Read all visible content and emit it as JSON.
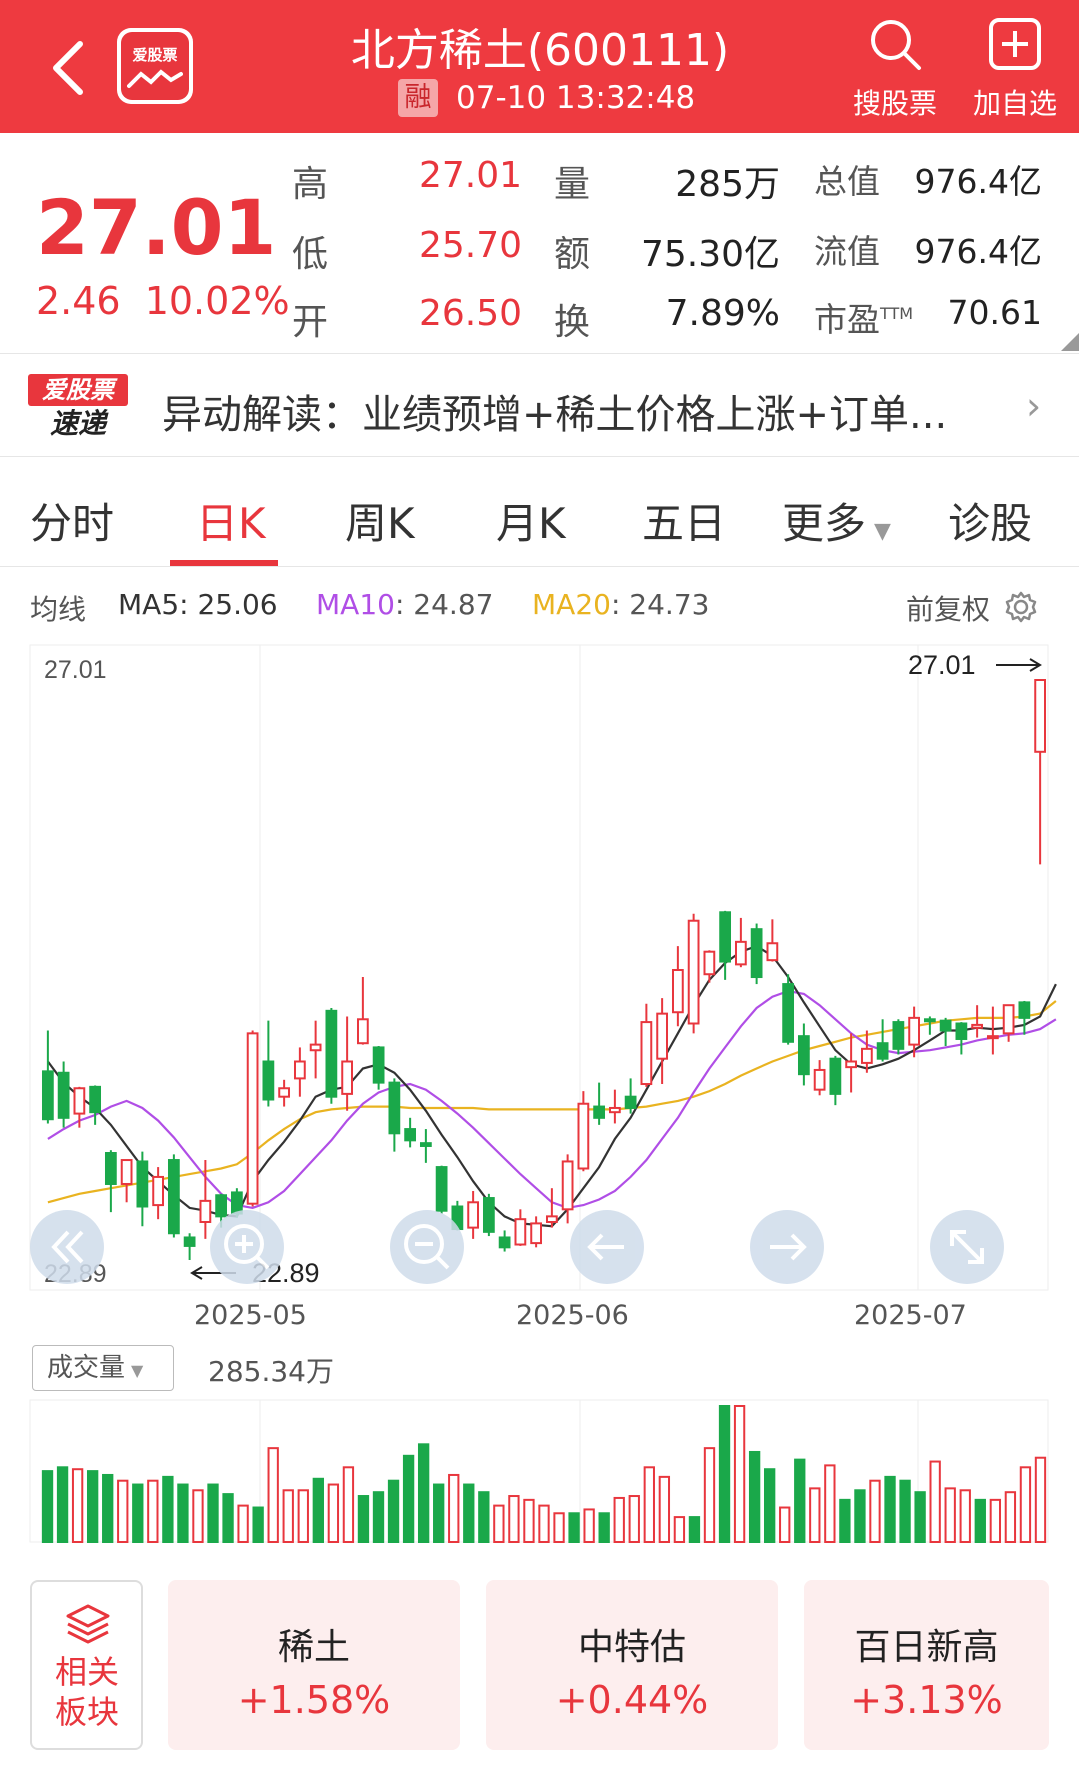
{
  "header": {
    "title": "北方稀土(600111)",
    "logo_text": "爱股票",
    "margin_badge": "融",
    "timestamp": "07-10 13:32:48",
    "search_label": "搜股票",
    "add_label": "加自选"
  },
  "quote": {
    "price": "27.01",
    "change": "2.46",
    "change_pct": "10.02%",
    "rows": [
      {
        "l1": "高",
        "v1": "27.01",
        "l2": "量",
        "v2": "285万",
        "l3": "总值",
        "v3": "976.4亿"
      },
      {
        "l1": "低",
        "v1": "25.70",
        "l2": "额",
        "v2": "75.30亿",
        "l3": "流值",
        "v3": "976.4亿"
      },
      {
        "l1": "开",
        "v1": "26.50",
        "l2": "换",
        "v2": "7.89%",
        "l3": "市盈",
        "l3_sup": "TTM",
        "v3": "70.61"
      }
    ]
  },
  "news": {
    "badge_top": "爱股票",
    "badge_bottom": "速递",
    "text": "异动解读：业绩预增+稀土价格上涨+订单..."
  },
  "tabs": [
    "分时",
    "日K",
    "周K",
    "月K",
    "五日",
    "更多",
    "诊股"
  ],
  "active_tab": 1,
  "ma": {
    "label": "均线",
    "ma5": "MA5: 25.06",
    "ma10_name": "MA10",
    "ma10_val": ": 24.87",
    "ma20_name": "MA20",
    "ma20_val": ": 24.73",
    "adjust": "前复权"
  },
  "colors": {
    "up": "#e8363d",
    "down": "#1aa84a",
    "ma5": "#333333",
    "ma10": "#b04ee6",
    "ma20": "#e9b320"
  },
  "chart_data": {
    "type": "candlestick",
    "price_max_label": "27.01",
    "price_min_label": "22.89",
    "high_marker": "27.01",
    "low_marker": "22.89",
    "ylim": [
      22.89,
      27.01
    ],
    "x_labels": [
      "2025-05",
      "2025-06",
      "2025-07"
    ],
    "candles": [
      {
        "o": 24.23,
        "h": 24.52,
        "l": 23.86,
        "c": 23.89
      },
      {
        "o": 24.22,
        "h": 24.3,
        "l": 23.83,
        "c": 23.9
      },
      {
        "o": 23.93,
        "h": 24.12,
        "l": 23.83,
        "c": 24.11
      },
      {
        "o": 24.12,
        "h": 24.13,
        "l": 23.85,
        "c": 23.94
      },
      {
        "o": 23.65,
        "h": 23.67,
        "l": 23.23,
        "c": 23.43
      },
      {
        "o": 23.43,
        "h": 23.47,
        "l": 23.3,
        "c": 23.6
      },
      {
        "o": 23.59,
        "h": 23.66,
        "l": 23.13,
        "c": 23.27
      },
      {
        "o": 23.28,
        "h": 23.55,
        "l": 23.18,
        "c": 23.48
      },
      {
        "o": 23.6,
        "h": 23.64,
        "l": 23.05,
        "c": 23.08
      },
      {
        "o": 23.05,
        "h": 23.08,
        "l": 22.89,
        "c": 22.99
      },
      {
        "o": 23.16,
        "h": 23.6,
        "l": 23.04,
        "c": 23.31
      },
      {
        "o": 23.35,
        "h": 23.36,
        "l": 23.12,
        "c": 23.2
      },
      {
        "o": 23.37,
        "h": 23.4,
        "l": 23.19,
        "c": 23.22
      },
      {
        "o": 23.29,
        "h": 24.52,
        "l": 23.27,
        "c": 24.5
      },
      {
        "o": 24.3,
        "h": 24.59,
        "l": 23.98,
        "c": 24.03
      },
      {
        "o": 24.05,
        "h": 24.17,
        "l": 23.98,
        "c": 24.11
      },
      {
        "o": 24.18,
        "h": 24.4,
        "l": 24.05,
        "c": 24.3
      },
      {
        "o": 24.38,
        "h": 24.59,
        "l": 24.18,
        "c": 24.42
      },
      {
        "o": 24.66,
        "h": 24.68,
        "l": 24.0,
        "c": 24.05
      },
      {
        "o": 24.07,
        "h": 24.62,
        "l": 23.95,
        "c": 24.3
      },
      {
        "o": 24.43,
        "h": 24.9,
        "l": 24.42,
        "c": 24.6
      },
      {
        "o": 24.4,
        "h": 24.41,
        "l": 24.1,
        "c": 24.15
      },
      {
        "o": 24.15,
        "h": 24.18,
        "l": 23.66,
        "c": 23.79
      },
      {
        "o": 23.82,
        "h": 23.9,
        "l": 23.69,
        "c": 23.74
      },
      {
        "o": 23.72,
        "h": 23.82,
        "l": 23.58,
        "c": 23.7
      },
      {
        "o": 23.55,
        "h": 23.56,
        "l": 23.22,
        "c": 23.24
      },
      {
        "o": 23.27,
        "h": 23.31,
        "l": 23.1,
        "c": 23.11
      },
      {
        "o": 23.12,
        "h": 23.38,
        "l": 23.04,
        "c": 23.3
      },
      {
        "o": 23.33,
        "h": 23.36,
        "l": 23.06,
        "c": 23.09
      },
      {
        "o": 23.05,
        "h": 23.1,
        "l": 22.95,
        "c": 22.98
      },
      {
        "o": 23.0,
        "h": 23.25,
        "l": 22.99,
        "c": 23.18
      },
      {
        "o": 23.01,
        "h": 23.2,
        "l": 22.98,
        "c": 23.15
      },
      {
        "o": 23.16,
        "h": 23.4,
        "l": 23.12,
        "c": 23.2
      },
      {
        "o": 23.25,
        "h": 23.64,
        "l": 23.15,
        "c": 23.59
      },
      {
        "o": 23.54,
        "h": 24.09,
        "l": 23.52,
        "c": 24.0
      },
      {
        "o": 23.98,
        "h": 24.15,
        "l": 23.85,
        "c": 23.9
      },
      {
        "o": 23.94,
        "h": 24.1,
        "l": 23.86,
        "c": 23.97
      },
      {
        "o": 24.05,
        "h": 24.18,
        "l": 23.93,
        "c": 23.97
      },
      {
        "o": 24.14,
        "h": 24.71,
        "l": 24.12,
        "c": 24.58
      },
      {
        "o": 24.32,
        "h": 24.75,
        "l": 24.14,
        "c": 24.64
      },
      {
        "o": 24.65,
        "h": 25.12,
        "l": 24.55,
        "c": 24.95
      },
      {
        "o": 24.57,
        "h": 25.35,
        "l": 24.5,
        "c": 25.3
      },
      {
        "o": 24.92,
        "h": 25.09,
        "l": 24.86,
        "c": 25.08
      },
      {
        "o": 25.36,
        "h": 25.37,
        "l": 24.88,
        "c": 25.01
      },
      {
        "o": 24.99,
        "h": 25.32,
        "l": 24.97,
        "c": 25.15
      },
      {
        "o": 25.24,
        "h": 25.28,
        "l": 24.85,
        "c": 24.9
      },
      {
        "o": 25.02,
        "h": 25.31,
        "l": 25.01,
        "c": 25.14
      },
      {
        "o": 24.85,
        "h": 24.92,
        "l": 24.42,
        "c": 24.44
      },
      {
        "o": 24.48,
        "h": 24.57,
        "l": 24.13,
        "c": 24.21
      },
      {
        "o": 24.1,
        "h": 24.31,
        "l": 24.06,
        "c": 24.24
      },
      {
        "o": 24.32,
        "h": 24.34,
        "l": 23.99,
        "c": 24.07
      },
      {
        "o": 24.26,
        "h": 24.5,
        "l": 24.08,
        "c": 24.3
      },
      {
        "o": 24.29,
        "h": 24.52,
        "l": 24.22,
        "c": 24.39
      },
      {
        "o": 24.43,
        "h": 24.6,
        "l": 24.3,
        "c": 24.32
      },
      {
        "o": 24.58,
        "h": 24.6,
        "l": 24.35,
        "c": 24.39
      },
      {
        "o": 24.42,
        "h": 24.69,
        "l": 24.33,
        "c": 24.61
      },
      {
        "o": 24.6,
        "h": 24.62,
        "l": 24.49,
        "c": 24.59
      },
      {
        "o": 24.59,
        "h": 24.61,
        "l": 24.41,
        "c": 24.52
      },
      {
        "o": 24.57,
        "h": 24.58,
        "l": 24.35,
        "c": 24.46
      },
      {
        "o": 24.54,
        "h": 24.7,
        "l": 24.47,
        "c": 24.56
      },
      {
        "o": 24.47,
        "h": 24.69,
        "l": 24.35,
        "c": 24.48
      },
      {
        "o": 24.5,
        "h": 24.67,
        "l": 24.44,
        "c": 24.7
      },
      {
        "o": 24.72,
        "h": 24.73,
        "l": 24.49,
        "c": 24.61
      },
      {
        "o": 26.5,
        "h": 27.01,
        "l": 25.7,
        "c": 27.01
      }
    ],
    "ma5": [
      24.3,
      24.15,
      24.05,
      23.97,
      23.85,
      23.7,
      23.55,
      23.45,
      23.35,
      23.26,
      23.24,
      23.21,
      23.2,
      23.45,
      23.6,
      23.73,
      23.88,
      24.05,
      24.1,
      24.12,
      24.25,
      24.28,
      24.22,
      24.1,
      23.95,
      23.78,
      23.62,
      23.45,
      23.3,
      23.2,
      23.15,
      23.14,
      23.13,
      23.25,
      23.4,
      23.55,
      23.75,
      23.9,
      24.1,
      24.3,
      24.5,
      24.7,
      24.88,
      25.0,
      25.08,
      25.12,
      25.05,
      24.9,
      24.72,
      24.55,
      24.38,
      24.28,
      24.25,
      24.28,
      24.32,
      24.38,
      24.45,
      24.52,
      24.52,
      24.54,
      24.53,
      24.54,
      24.56,
      24.62,
      24.85
    ],
    "ma10": [
      23.75,
      23.82,
      23.88,
      23.92,
      23.98,
      24.02,
      23.97,
      23.88,
      23.76,
      23.62,
      23.48,
      23.36,
      23.28,
      23.26,
      23.3,
      23.38,
      23.5,
      23.62,
      23.74,
      23.88,
      24.0,
      24.08,
      24.12,
      24.14,
      24.1,
      24.02,
      23.93,
      23.83,
      23.72,
      23.61,
      23.5,
      23.4,
      23.3,
      23.26,
      23.28,
      23.32,
      23.38,
      23.48,
      23.6,
      23.75,
      23.9,
      24.08,
      24.25,
      24.4,
      24.55,
      24.68,
      24.76,
      24.8,
      24.78,
      24.7,
      24.6,
      24.5,
      24.42,
      24.38,
      24.36,
      24.37,
      24.38,
      24.4,
      24.42,
      24.45,
      24.47,
      24.49,
      24.5,
      24.53,
      24.6
    ],
    "ma20": [
      23.3,
      23.33,
      23.36,
      23.38,
      23.4,
      23.42,
      23.44,
      23.46,
      23.48,
      23.5,
      23.52,
      23.54,
      23.57,
      23.65,
      23.74,
      23.82,
      23.89,
      23.94,
      23.96,
      23.97,
      23.98,
      23.98,
      23.98,
      23.97,
      23.97,
      23.97,
      23.97,
      23.97,
      23.96,
      23.96,
      23.96,
      23.96,
      23.96,
      23.96,
      23.96,
      23.96,
      23.96,
      23.97,
      23.98,
      24.0,
      24.02,
      24.05,
      24.09,
      24.14,
      24.2,
      24.25,
      24.3,
      24.34,
      24.38,
      24.41,
      24.44,
      24.47,
      24.49,
      24.51,
      24.53,
      24.55,
      24.57,
      24.59,
      24.6,
      24.61,
      24.61,
      24.61,
      24.62,
      24.64,
      24.73
    ],
    "volume": [
      37,
      39,
      38,
      37,
      35,
      32,
      30,
      32,
      34,
      30,
      27,
      30,
      25,
      19,
      18,
      49,
      27,
      27,
      33,
      30,
      39,
      24,
      26,
      32,
      45,
      51,
      30,
      35,
      30,
      26,
      19,
      24,
      22,
      19,
      15,
      15,
      17,
      15,
      23,
      24,
      39,
      34,
      13,
      13,
      49,
      71,
      71,
      47,
      38,
      18,
      43,
      28,
      40,
      22,
      27,
      32,
      34,
      32,
      26,
      42,
      28,
      27,
      22,
      22,
      26,
      39,
      44
    ],
    "volume_label": "成交量",
    "volume_value": "285.34万"
  },
  "sectors": {
    "related_label_1": "相关",
    "related_label_2": "板块",
    "items": [
      {
        "name": "稀土",
        "pct": "+1.58%"
      },
      {
        "name": "中特估",
        "pct": "+0.44%"
      },
      {
        "name": "百日新高",
        "pct": "+3.13%"
      }
    ]
  }
}
